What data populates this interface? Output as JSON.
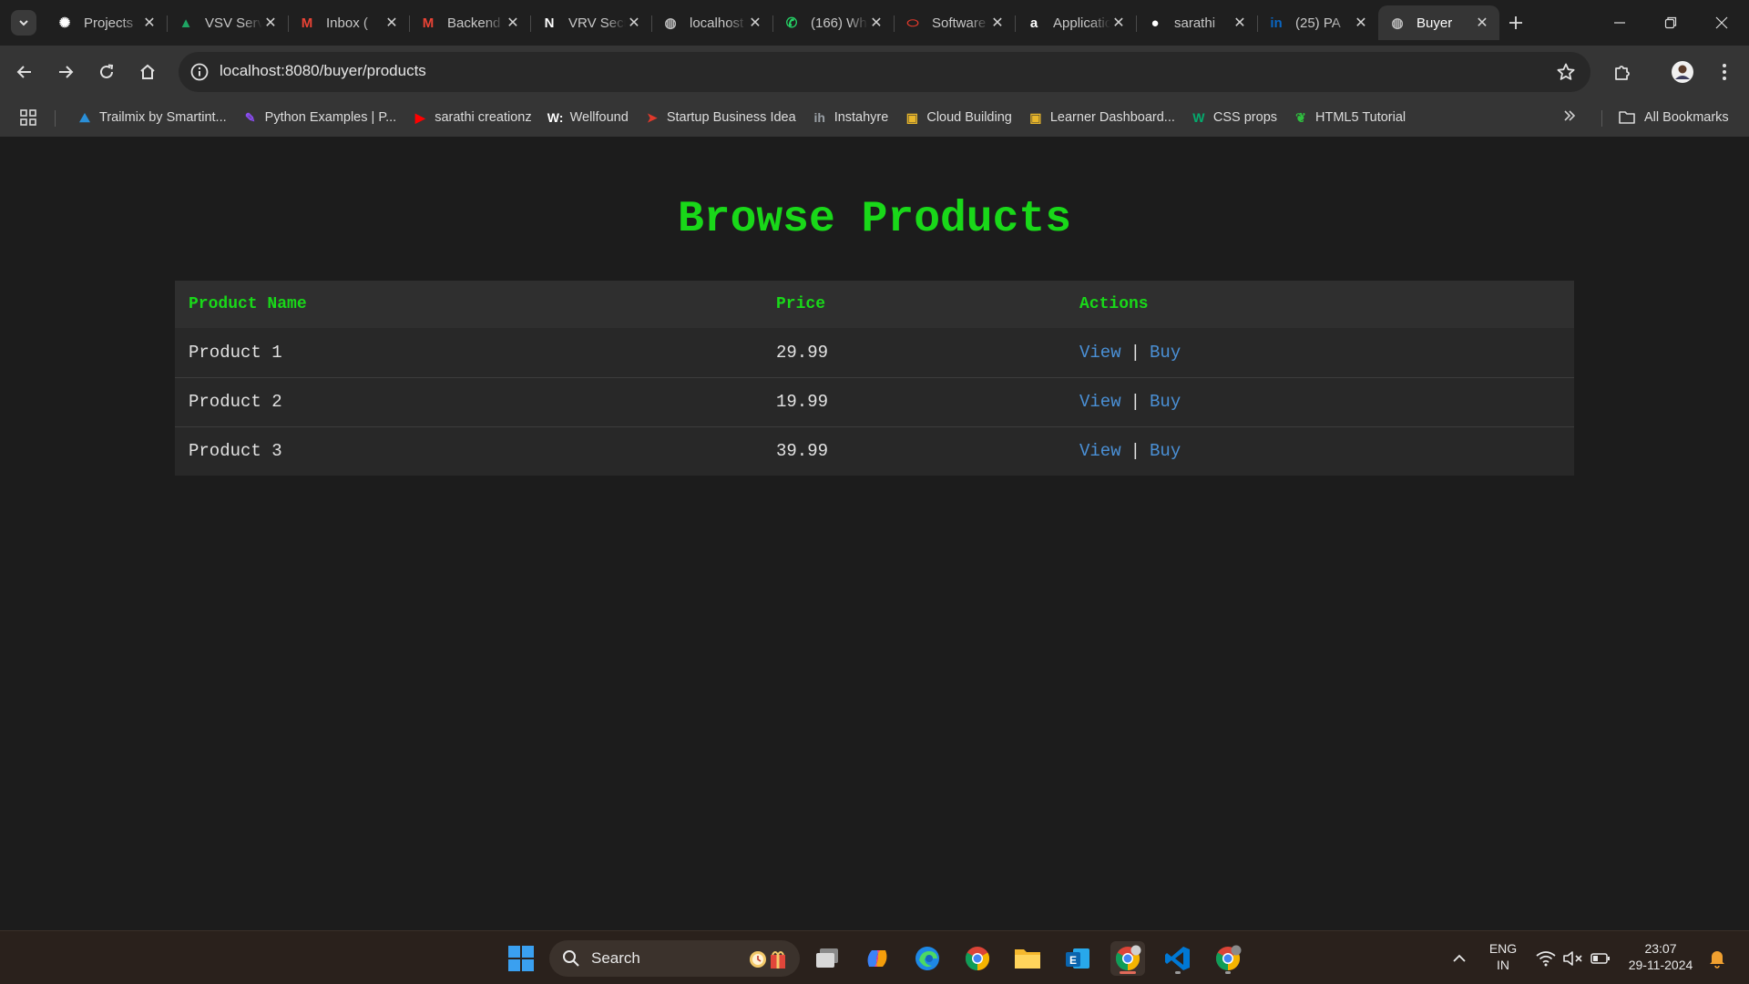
{
  "browser": {
    "tabs": [
      {
        "title": "Projects",
        "icon": "openai-icon",
        "color": "#ffffff"
      },
      {
        "title": "VSV Services",
        "icon": "google-drive-icon",
        "color": "#1fa463"
      },
      {
        "title": "Inbox (",
        "icon": "gmail-icon",
        "color": "#ea4335"
      },
      {
        "title": "Backend",
        "icon": "gmail-icon",
        "color": "#ea4335"
      },
      {
        "title": "VRV Security",
        "icon": "notion-icon",
        "color": "#ffffff"
      },
      {
        "title": "localhost",
        "icon": "globe-icon",
        "color": "#bdbdbd"
      },
      {
        "title": "(166) WhatsApp",
        "icon": "whatsapp-icon",
        "color": "#25d366"
      },
      {
        "title": "Software",
        "icon": "oracle-icon",
        "color": "#e0392b"
      },
      {
        "title": "Applications",
        "icon": "amazon-icon",
        "color": "#ffffff"
      },
      {
        "title": "sarathi",
        "icon": "github-icon",
        "color": "#ffffff"
      },
      {
        "title": "(25) PA",
        "icon": "linkedin-icon",
        "color": "#0a66c2"
      },
      {
        "title": "Buyer",
        "icon": "globe-icon",
        "color": "#bdbdbd",
        "active": true
      }
    ],
    "url": "localhost:8080/buyer/products"
  },
  "bookmarks": {
    "items": [
      {
        "label": "Trailmix by Smartint...",
        "icon": "trailhead-icon",
        "color": "#2a8fd8"
      },
      {
        "label": "Python Examples | P...",
        "icon": "python-examples-icon",
        "color": "#8a4cf0"
      },
      {
        "label": "sarathi creationz",
        "icon": "youtube-icon",
        "color": "#ff0000"
      },
      {
        "label": "Wellfound",
        "icon": "wellfound-icon",
        "color": "#ffffff"
      },
      {
        "label": "Startup Business Idea",
        "icon": "paper-plane-icon",
        "color": "#e0392b"
      },
      {
        "label": "Instahyre",
        "icon": "instahyre-icon",
        "color": "#9aa0a6"
      },
      {
        "label": "Cloud Building",
        "icon": "box-icon",
        "color": "#e8b62b"
      },
      {
        "label": "Learner Dashboard...",
        "icon": "box-icon",
        "color": "#e8b62b"
      },
      {
        "label": "CSS props",
        "icon": "w3-icon",
        "color": "#04aa6d"
      },
      {
        "label": "HTML5 Tutorial",
        "icon": "html-tutorial-icon",
        "color": "#2fbf3f"
      }
    ],
    "all_label": "All Bookmarks"
  },
  "page": {
    "title": "Browse Products",
    "columns": [
      "Product Name",
      "Price",
      "Actions"
    ],
    "rows": [
      {
        "name": "Product 1",
        "price": "29.99",
        "view": "View",
        "buy": "Buy"
      },
      {
        "name": "Product 2",
        "price": "19.99",
        "view": "View",
        "buy": "Buy"
      },
      {
        "name": "Product 3",
        "price": "39.99",
        "view": "View",
        "buy": "Buy"
      }
    ],
    "separator": "|"
  },
  "taskbar": {
    "search_label": "Search",
    "lang_line1": "ENG",
    "lang_line2": "IN",
    "time": "23:07",
    "date": "29-11-2024"
  },
  "colors": {
    "accent_green": "#19d819",
    "link_blue": "#4a90d6",
    "page_bg": "#1c1c1c"
  }
}
